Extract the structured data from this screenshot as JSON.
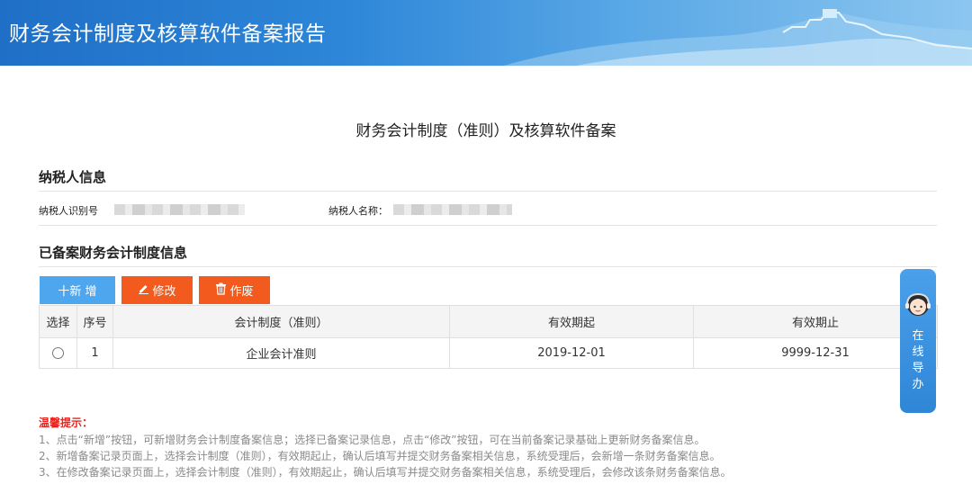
{
  "header": {
    "title": "财务会计制度及核算软件备案报告"
  },
  "page_title": "财务会计制度（准则）及核算软件备案",
  "taxpayer_section": {
    "title": "纳税人信息",
    "id_label": "纳税人识别号",
    "name_label": "纳税人名称："
  },
  "records_section": {
    "title": "已备案财务会计制度信息"
  },
  "toolbar": {
    "add_label": "十新 增",
    "edit_label": "修改",
    "void_label": "作废"
  },
  "table": {
    "headers": [
      "选择",
      "序号",
      "会计制度（准则）",
      "有效期起",
      "有效期止"
    ],
    "rows": [
      {
        "index": "1",
        "standard": "企业会计准则",
        "start": "2019-12-01",
        "end": "9999-12-31"
      }
    ]
  },
  "tips": {
    "title": "温馨提示：",
    "lines": [
      "1、点击“新增”按钮，可新增财务会计制度备案信息；选择已备案记录信息，点击“修改”按钮，可在当前备案记录基础上更新财务备案信息。",
      "2、新增备案记录页面上，选择会计制度（准则），有效期起止，确认后填写并提交财务备案相关信息，系统受理后，会新增一条财务备案信息。",
      "3、在修改备案记录页面上，选择会计制度（准则），有效期起止，确认后填写并提交财务备案相关信息，系统受理后，会修改该条财务备案信息。"
    ]
  },
  "online_help": {
    "chars": [
      "在",
      "线",
      "导",
      "办"
    ]
  },
  "colors": {
    "primary": "#4ea6ef",
    "danger": "#f25a1e",
    "tip_title": "#e8231f"
  },
  "icons": {
    "edit": "pencil-icon",
    "void": "trash-icon",
    "help": "customer-service-icon"
  }
}
